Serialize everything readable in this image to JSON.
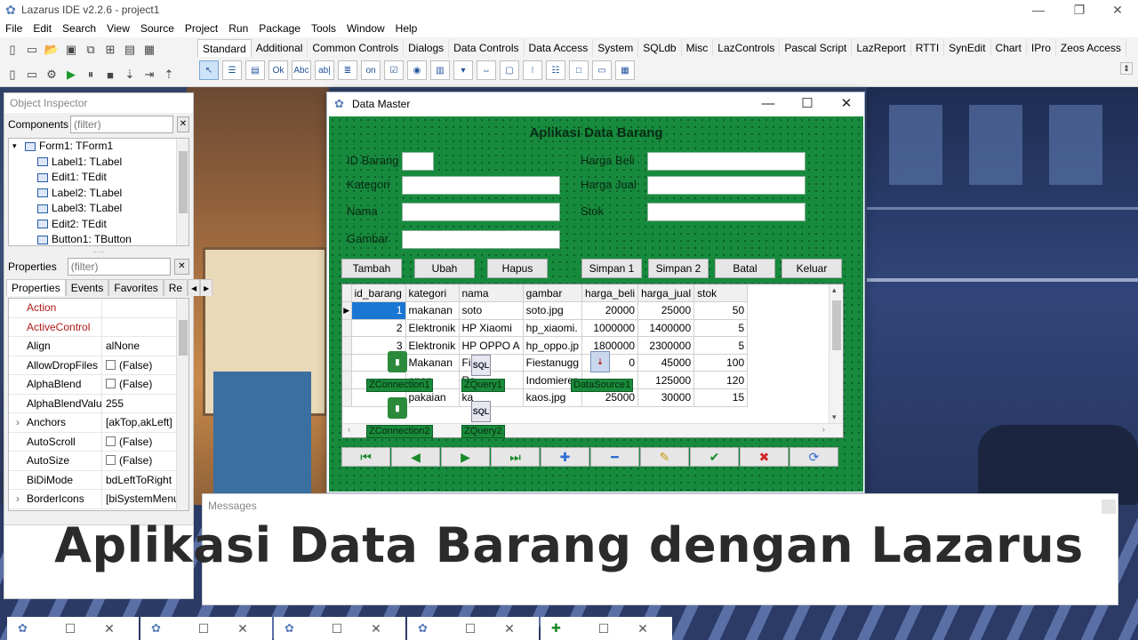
{
  "ide": {
    "title": "Lazarus IDE v2.2.6 - project1",
    "min_symbol": "—",
    "max_symbol": "❐",
    "close_symbol": "✕",
    "menu": [
      "File",
      "Edit",
      "Search",
      "View",
      "Source",
      "Project",
      "Run",
      "Package",
      "Tools",
      "Window",
      "Help"
    ],
    "palette_tabs": [
      "Standard",
      "Additional",
      "Common Controls",
      "Dialogs",
      "Data Controls",
      "Data Access",
      "System",
      "SQLdb",
      "Misc",
      "LazControls",
      "Pascal Script",
      "LazReport",
      "RTTI",
      "SynEdit",
      "Chart",
      "IPro",
      "Zeos Access"
    ]
  },
  "object_inspector": {
    "title": "Object Inspector",
    "components_label": "Components",
    "properties_label": "Properties",
    "filter_placeholder": "(filter)",
    "tree": [
      "Form1: TForm1",
      "Label1: TLabel",
      "Edit1: TEdit",
      "Label2: TLabel",
      "Label3: TLabel",
      "Edit2: TEdit",
      "Button1: TButton"
    ],
    "tabs": [
      "Properties",
      "Events",
      "Favorites",
      "Re"
    ],
    "props": [
      {
        "name": "Action",
        "value": "",
        "red": true
      },
      {
        "name": "ActiveControl",
        "value": "",
        "red": true
      },
      {
        "name": "Align",
        "value": "alNone"
      },
      {
        "name": "AllowDropFiles",
        "value": "(False)"
      },
      {
        "name": "AlphaBlend",
        "value": "(False)"
      },
      {
        "name": "AlphaBlendValu",
        "value": "255"
      },
      {
        "name": "Anchors",
        "value": "[akTop,akLeft]"
      },
      {
        "name": "AutoScroll",
        "value": "(False)"
      },
      {
        "name": "AutoSize",
        "value": "(False)"
      },
      {
        "name": "BiDiMode",
        "value": "bdLeftToRight"
      },
      {
        "name": "BorderIcons",
        "value": "[biSystemMenu,l"
      }
    ]
  },
  "form": {
    "window_title": "Data Master",
    "heading": "Aplikasi Data Barang",
    "labels": {
      "id_barang": "ID Barang",
      "kategori": "Kategori",
      "nama": "Nama",
      "gambar": "Gambar",
      "harga_beli": "Harga Beli",
      "harga_jual": "Harga Jual",
      "stok": "Stok"
    },
    "buttons": {
      "tambah": "Tambah",
      "ubah": "Ubah",
      "hapus": "Hapus",
      "simpan1": "Simpan 1",
      "simpan2": "Simpan 2",
      "batal": "Batal",
      "keluar": "Keluar"
    },
    "grid": {
      "columns": [
        "id_barang",
        "kategori",
        "nama",
        "gambar",
        "harga_beli",
        "harga_jual",
        "stok"
      ],
      "rows": [
        [
          "1",
          "makanan",
          "soto",
          "soto.jpg",
          "20000",
          "25000",
          "50"
        ],
        [
          "2",
          "Elektronik",
          "HP Xiaomi",
          "hp_xiaomi.",
          "1000000",
          "1400000",
          "5"
        ],
        [
          "3",
          "Elektronik",
          "HP OPPO A",
          "hp_oppo.jp",
          "1800000",
          "2300000",
          "5"
        ],
        [
          "",
          "Makanan",
          "Fi   hic",
          "Fiestanugg",
          "0",
          "45000",
          "100"
        ],
        [
          "",
          "  enan",
          "  Ra",
          "Indomierer",
          "",
          "125000",
          "120"
        ],
        [
          "",
          " pakaian",
          "ka",
          "kaos.jpg",
          "25000",
          "30000",
          "15"
        ]
      ]
    },
    "components": {
      "zconnection1": "ZConnection1",
      "zquery1": "ZQuery1",
      "datasource1": "DataSource1",
      "zconnection2": "ZConnection2",
      "zquery2": "ZQuery2",
      "sql_text": "SQL"
    },
    "nav_buttons": [
      "⏮",
      "◀",
      "▶",
      "⏭",
      "✚",
      "━",
      "✎",
      "✔",
      "✖",
      "⟳"
    ]
  },
  "messages": {
    "title": "Messages"
  },
  "overlay_title": "Aplikasi Data Barang dengan Lazarus",
  "colors": {
    "form_green": "#178a3d",
    "grid_selection": "#1976d2",
    "title_text": "#2b2b2b"
  }
}
